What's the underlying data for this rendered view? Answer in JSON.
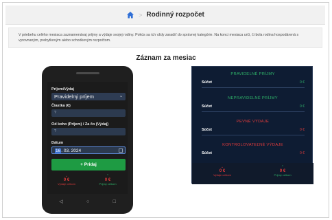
{
  "header": {
    "title": "Rodinný rozpočet",
    "separator": ">"
  },
  "intro": {
    "text": "V priebehu celého mesiaca zaznamenávaj príjmy a výdaje svojej rodiny. Pokús sa ich vždy zaradiť do správnej kategórie. Na konci mesiaca urči, či bola rodina hospodárená s vyrovnaným, prebytkovým alebo schodkovým rozpočtom."
  },
  "section_title": "Záznam za mesiac",
  "form": {
    "type_label": "Príjem/Výdaj",
    "type_value": "Pravidelný príjem",
    "amount_label": "Čiastka (€)",
    "amount_placeholder": "?",
    "from_label": "Od koho (Príjem) / Za čo (Výdaj)",
    "from_placeholder": "?",
    "date_label": "Dátum",
    "date_day": "16",
    "date_rest": ". 03. 2024",
    "add_button": "+ Pridaj"
  },
  "phone_stats": {
    "expenses": {
      "arrow": "⌄",
      "value": "0 €",
      "label": "Výdaje celkom"
    },
    "income": {
      "arrow": "⌃",
      "value": "0 €",
      "label": "Príjmy celkom"
    }
  },
  "phone_nav": {
    "back": "◁",
    "home": "○",
    "recent": "□"
  },
  "panel": {
    "regular_income_title": "PRAVIDELNÉ PRÍJMY",
    "irregular_income_title": "NEPRAVIDELNÉ PRÍJMY",
    "fixed_expenses_title": "PEVNÉ VÝDAJE",
    "controlled_expenses_title": "KONTROLOVATEĽNÉ VÝDAJE",
    "sum_label": "Súčet",
    "sum_value": "0 €",
    "foot_expenses": {
      "arrow": "⌄",
      "value": "0 €",
      "label": "Výdaje celkom"
    },
    "foot_income": {
      "arrow": "⌃",
      "value": "0 €",
      "label": "Príjmy celkom"
    }
  }
}
